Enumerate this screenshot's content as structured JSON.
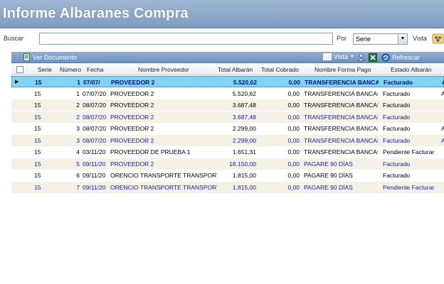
{
  "window": {
    "title": "Informe Albaranes Compra"
  },
  "search": {
    "buscar_label": "Buscar",
    "value": "",
    "por_label": "Por",
    "por_value": "Serie",
    "vista_label": "Vista"
  },
  "toolbar": {
    "ver_documento": "Ver Documento",
    "vista": "Vista",
    "refrescar": "Refrescar"
  },
  "table": {
    "columns": [
      "Serie",
      "Número",
      "Fecha",
      "Nombre Proveedor",
      "Total Albarán",
      "Total Cobrado",
      "Nombre Forma Pago",
      "Estado Albarán"
    ],
    "rows": [
      {
        "serie": "15",
        "numero": "1",
        "fecha": "07/07/",
        "proveedor": "PROVEEDOR 2",
        "total": "5.520,62",
        "cobrado": "0,00",
        "forma_pago": "TRANSFERENCIA BANCA",
        "estado": "Facturado",
        "extra": "A"
      },
      {
        "serie": "15",
        "numero": "1",
        "fecha": "07/07/20",
        "proveedor": "PROVEEDOR 2",
        "total": "5.520,62",
        "cobrado": "0,00",
        "forma_pago": "TRANSFERENCIA BANCARIA",
        "estado": "Facturado",
        "extra": "A"
      },
      {
        "serie": "15",
        "numero": "2",
        "fecha": "08/07/20",
        "proveedor": "PROVEEDOR 2",
        "total": "3.687,48",
        "cobrado": "0,00",
        "forma_pago": "TRANSFERENCIA BANCARIA",
        "estado": "Facturado",
        "extra": ""
      },
      {
        "serie": "15",
        "numero": "2",
        "fecha": "08/07/20",
        "proveedor": "PROVEEDOR 2",
        "total": "3.687,48",
        "cobrado": "0,00",
        "forma_pago": "TRANSFERENCIA BANCARIA",
        "estado": "Facturado",
        "extra": ""
      },
      {
        "serie": "15",
        "numero": "3",
        "fecha": "08/07/20",
        "proveedor": "PROVEEDOR 2",
        "total": "2.299,00",
        "cobrado": "0,00",
        "forma_pago": "TRANSFERENCIA BANCARIA",
        "estado": "Facturado",
        "extra": "A"
      },
      {
        "serie": "15",
        "numero": "3",
        "fecha": "08/07/20",
        "proveedor": "PROVEEDOR 2",
        "total": "2.299,00",
        "cobrado": "0,00",
        "forma_pago": "TRANSFERENCIA BANCARIA",
        "estado": "Facturado",
        "extra": "A"
      },
      {
        "serie": "15",
        "numero": "4",
        "fecha": "03/11/20",
        "proveedor": "PROVEEDOR DE PRUEBA 1",
        "total": "1.651,31",
        "cobrado": "0,00",
        "forma_pago": "TRANSFERENCIA BANCARIA",
        "estado": "Pendiente Facturar",
        "extra": ""
      },
      {
        "serie": "15",
        "numero": "5",
        "fecha": "09/11/20",
        "proveedor": "PROVEEDOR 2",
        "total": "18.150,00",
        "cobrado": "0,00",
        "forma_pago": "PAGARE 90 DÍAS",
        "estado": "Facturado",
        "extra": ""
      },
      {
        "serie": "15",
        "numero": "6",
        "fecha": "09/11/20",
        "proveedor": "ORENCIO TRANSPORTE TRANSPORTE",
        "total": "1.815,00",
        "cobrado": "0,00",
        "forma_pago": "PAGARE 90 DÍAS",
        "estado": "Facturado",
        "extra": ""
      },
      {
        "serie": "15",
        "numero": "7",
        "fecha": "09/11/20",
        "proveedor": "ORENCIO TRANSPORTE TRANSPORTE",
        "total": "1.815,00",
        "cobrado": "0,00",
        "forma_pago": "PAGARE 90 DÍAS",
        "estado": "Pendiente Facturar",
        "extra": ""
      }
    ]
  },
  "colors": {
    "title_bar": "#8fa9ca",
    "toolbar": "#7f9fc8",
    "selected_row": "#7fd3f3",
    "alt_row": "#f5f1e6",
    "blue_text": "#1a1aa8"
  },
  "icons": {
    "ver_documento": "document-icon",
    "vista": "view-icon",
    "user": "user-icon",
    "excel": "excel-icon",
    "refrescar": "refresh-icon",
    "select": "chevron-down-icon",
    "vista_button": "palette-icon",
    "row_pointer": "row-pointer-icon"
  }
}
